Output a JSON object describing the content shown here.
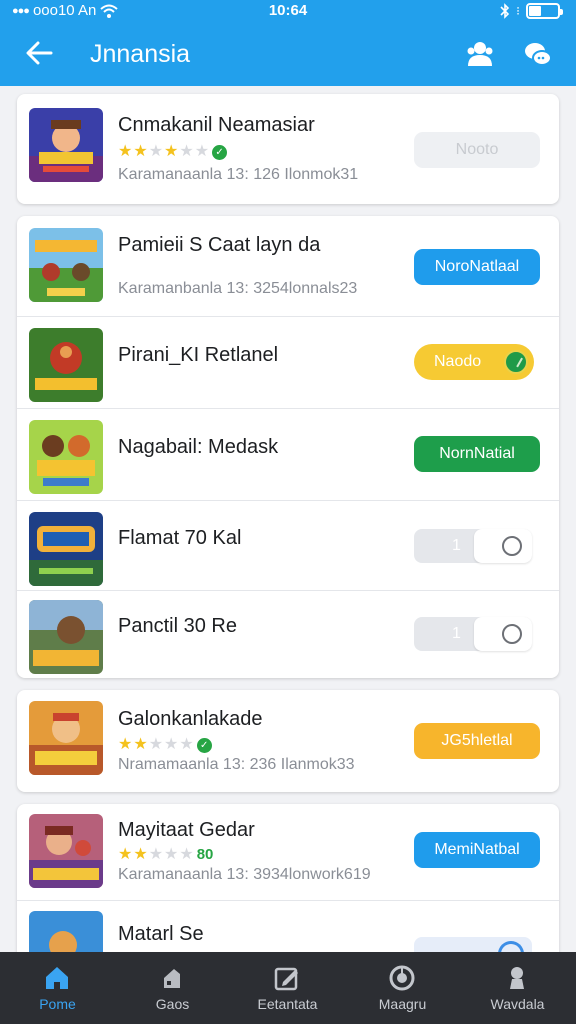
{
  "status_bar": {
    "carrier": "ooo10 An",
    "time": "10:64"
  },
  "header": {
    "title": "Jnnansia",
    "back_icon": "back-arrow-icon",
    "action_icons": [
      "users-icon",
      "chat-icon"
    ]
  },
  "apps": [
    {
      "name": "Cnmakanil Neamasiar",
      "rating": 4,
      "rating_badge": "check",
      "meta": "Karamanaanla 13: 126 Ilonmok31",
      "action": {
        "type": "button",
        "label": "Nooto",
        "style": "disabled"
      }
    },
    {
      "name": "Pamieii S Caat layn da",
      "meta": "Karamanbanla 13: 3254lonnals23",
      "action": {
        "type": "button",
        "label": "NoroNatlaal",
        "style": "blue"
      }
    },
    {
      "name": "Pirani_KI Retlanel",
      "action": {
        "type": "button",
        "label": "Naodo",
        "style": "yellow"
      }
    },
    {
      "name": "Nagabail: Medask",
      "action": {
        "type": "button",
        "label": "NornNatial",
        "style": "green"
      }
    },
    {
      "name": "Flamat 70 Kal",
      "action": {
        "type": "toggle",
        "value": "1"
      }
    },
    {
      "name": "Panctil 30 Re",
      "action": {
        "type": "toggle",
        "value": "1"
      }
    },
    {
      "name": "Galonkanlakade",
      "rating": 2,
      "rating_badge": "check",
      "meta": "Nramamaanla 13: 236 Ilanmok33",
      "action": {
        "type": "button",
        "label": "JG5hletlal",
        "style": "orange"
      }
    },
    {
      "name": "Mayitaat Gedar",
      "rating": 2,
      "rating_badge": "80",
      "meta": "Karamanaanla 13: 3934lonwork619",
      "action": {
        "type": "button",
        "label": "MemiNatbal",
        "style": "blue"
      }
    },
    {
      "name": "Matarl Se",
      "action": {
        "type": "partial"
      }
    }
  ],
  "tabs": [
    {
      "label": "Pome",
      "icon": "home-icon",
      "active": true
    },
    {
      "label": "Gaos",
      "icon": "games-icon",
      "active": false
    },
    {
      "label": "Eetantata",
      "icon": "edit-icon",
      "active": false
    },
    {
      "label": "Maagru",
      "icon": "dial-icon",
      "active": false
    },
    {
      "label": "Wavdala",
      "icon": "person-icon",
      "active": false
    }
  ],
  "colors": {
    "header": "#22a0ec",
    "tabbar": "#2c2e33",
    "active_tab": "#3aa4f2",
    "blue": "#1f9cec",
    "green": "#1e9e4b",
    "orange": "#f7b52c",
    "yellow": "#f6ca33"
  }
}
